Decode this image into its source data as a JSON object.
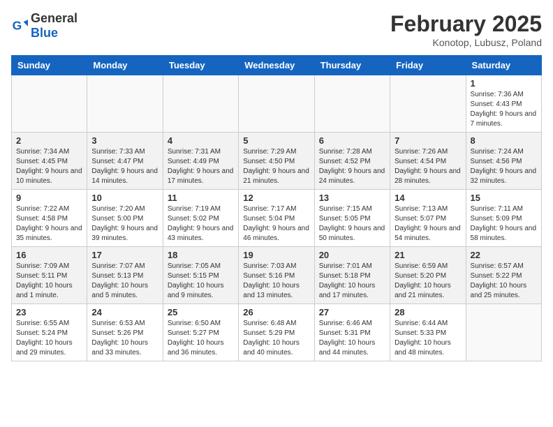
{
  "header": {
    "logo": {
      "general": "General",
      "blue": "Blue"
    },
    "title": "February 2025",
    "location": "Konotop, Lubusz, Poland"
  },
  "weekdays": [
    "Sunday",
    "Monday",
    "Tuesday",
    "Wednesday",
    "Thursday",
    "Friday",
    "Saturday"
  ],
  "weeks": [
    [
      {
        "day": "",
        "info": ""
      },
      {
        "day": "",
        "info": ""
      },
      {
        "day": "",
        "info": ""
      },
      {
        "day": "",
        "info": ""
      },
      {
        "day": "",
        "info": ""
      },
      {
        "day": "",
        "info": ""
      },
      {
        "day": "1",
        "info": "Sunrise: 7:36 AM\nSunset: 4:43 PM\nDaylight: 9 hours and 7 minutes."
      }
    ],
    [
      {
        "day": "2",
        "info": "Sunrise: 7:34 AM\nSunset: 4:45 PM\nDaylight: 9 hours and 10 minutes."
      },
      {
        "day": "3",
        "info": "Sunrise: 7:33 AM\nSunset: 4:47 PM\nDaylight: 9 hours and 14 minutes."
      },
      {
        "day": "4",
        "info": "Sunrise: 7:31 AM\nSunset: 4:49 PM\nDaylight: 9 hours and 17 minutes."
      },
      {
        "day": "5",
        "info": "Sunrise: 7:29 AM\nSunset: 4:50 PM\nDaylight: 9 hours and 21 minutes."
      },
      {
        "day": "6",
        "info": "Sunrise: 7:28 AM\nSunset: 4:52 PM\nDaylight: 9 hours and 24 minutes."
      },
      {
        "day": "7",
        "info": "Sunrise: 7:26 AM\nSunset: 4:54 PM\nDaylight: 9 hours and 28 minutes."
      },
      {
        "day": "8",
        "info": "Sunrise: 7:24 AM\nSunset: 4:56 PM\nDaylight: 9 hours and 32 minutes."
      }
    ],
    [
      {
        "day": "9",
        "info": "Sunrise: 7:22 AM\nSunset: 4:58 PM\nDaylight: 9 hours and 35 minutes."
      },
      {
        "day": "10",
        "info": "Sunrise: 7:20 AM\nSunset: 5:00 PM\nDaylight: 9 hours and 39 minutes."
      },
      {
        "day": "11",
        "info": "Sunrise: 7:19 AM\nSunset: 5:02 PM\nDaylight: 9 hours and 43 minutes."
      },
      {
        "day": "12",
        "info": "Sunrise: 7:17 AM\nSunset: 5:04 PM\nDaylight: 9 hours and 46 minutes."
      },
      {
        "day": "13",
        "info": "Sunrise: 7:15 AM\nSunset: 5:05 PM\nDaylight: 9 hours and 50 minutes."
      },
      {
        "day": "14",
        "info": "Sunrise: 7:13 AM\nSunset: 5:07 PM\nDaylight: 9 hours and 54 minutes."
      },
      {
        "day": "15",
        "info": "Sunrise: 7:11 AM\nSunset: 5:09 PM\nDaylight: 9 hours and 58 minutes."
      }
    ],
    [
      {
        "day": "16",
        "info": "Sunrise: 7:09 AM\nSunset: 5:11 PM\nDaylight: 10 hours and 1 minute."
      },
      {
        "day": "17",
        "info": "Sunrise: 7:07 AM\nSunset: 5:13 PM\nDaylight: 10 hours and 5 minutes."
      },
      {
        "day": "18",
        "info": "Sunrise: 7:05 AM\nSunset: 5:15 PM\nDaylight: 10 hours and 9 minutes."
      },
      {
        "day": "19",
        "info": "Sunrise: 7:03 AM\nSunset: 5:16 PM\nDaylight: 10 hours and 13 minutes."
      },
      {
        "day": "20",
        "info": "Sunrise: 7:01 AM\nSunset: 5:18 PM\nDaylight: 10 hours and 17 minutes."
      },
      {
        "day": "21",
        "info": "Sunrise: 6:59 AM\nSunset: 5:20 PM\nDaylight: 10 hours and 21 minutes."
      },
      {
        "day": "22",
        "info": "Sunrise: 6:57 AM\nSunset: 5:22 PM\nDaylight: 10 hours and 25 minutes."
      }
    ],
    [
      {
        "day": "23",
        "info": "Sunrise: 6:55 AM\nSunset: 5:24 PM\nDaylight: 10 hours and 29 minutes."
      },
      {
        "day": "24",
        "info": "Sunrise: 6:53 AM\nSunset: 5:26 PM\nDaylight: 10 hours and 33 minutes."
      },
      {
        "day": "25",
        "info": "Sunrise: 6:50 AM\nSunset: 5:27 PM\nDaylight: 10 hours and 36 minutes."
      },
      {
        "day": "26",
        "info": "Sunrise: 6:48 AM\nSunset: 5:29 PM\nDaylight: 10 hours and 40 minutes."
      },
      {
        "day": "27",
        "info": "Sunrise: 6:46 AM\nSunset: 5:31 PM\nDaylight: 10 hours and 44 minutes."
      },
      {
        "day": "28",
        "info": "Sunrise: 6:44 AM\nSunset: 5:33 PM\nDaylight: 10 hours and 48 minutes."
      },
      {
        "day": "",
        "info": ""
      }
    ]
  ]
}
